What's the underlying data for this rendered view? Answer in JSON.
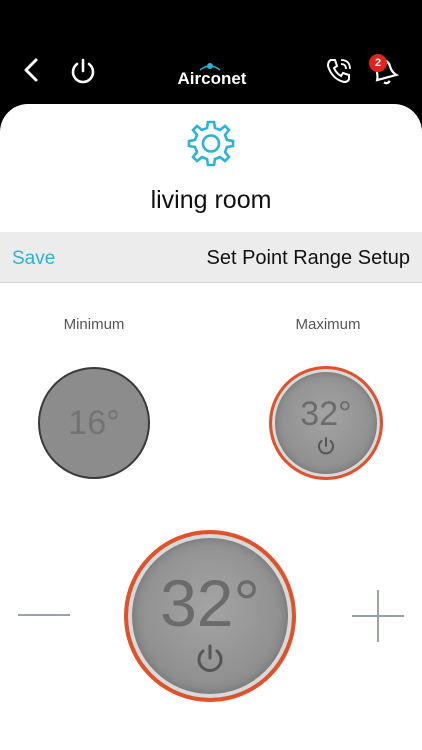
{
  "header": {
    "logo_text": "AirconeT",
    "notification_count": "2"
  },
  "page": {
    "room_name": "living room"
  },
  "toolbar": {
    "save_label": "Save",
    "title": "Set Point Range Setup"
  },
  "range": {
    "minimum_label": "Minimum",
    "maximum_label": "Maximum",
    "minimum_value": "16°",
    "maximum_value": "32°"
  },
  "main_dial": {
    "value": "32°"
  },
  "colors": {
    "accent": "#2ab3d6",
    "ring": "#e0522c",
    "badge": "#e2231a"
  }
}
